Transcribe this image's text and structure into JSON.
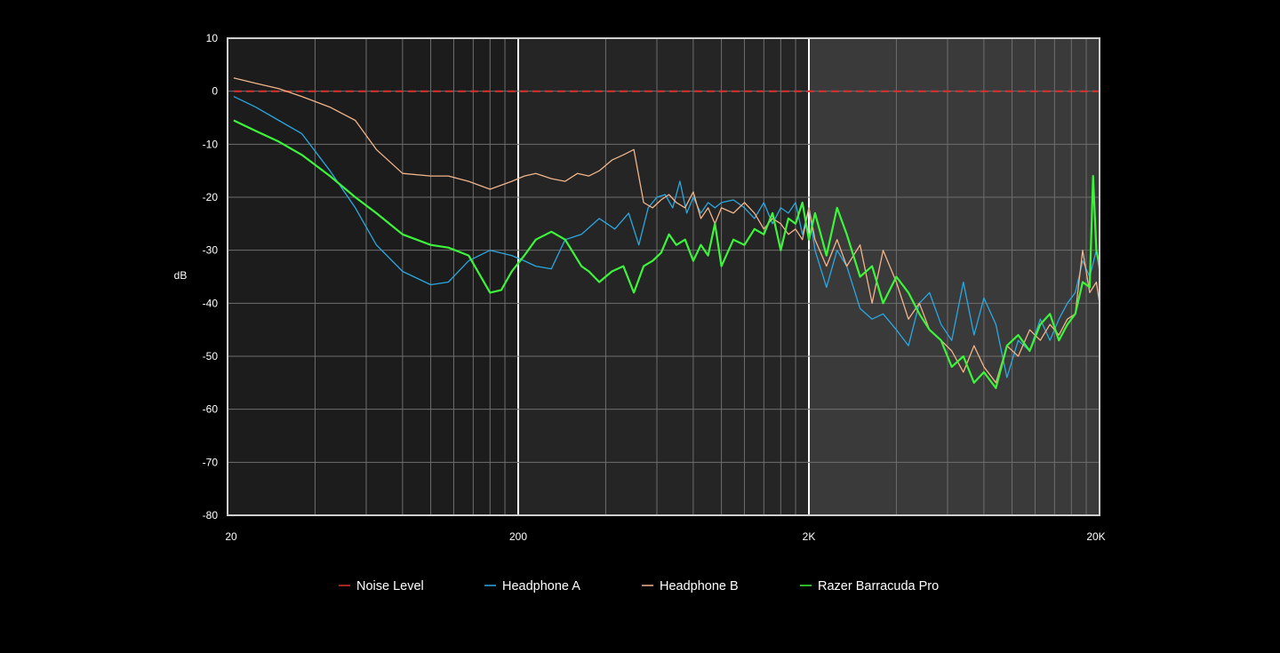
{
  "chart_data": {
    "type": "line",
    "title": "",
    "xlabel": "",
    "ylabel": "dB",
    "x_scale": "log",
    "xlim": [
      20,
      20000
    ],
    "ylim": [
      -80,
      10
    ],
    "x_ticks": [
      {
        "value": 20,
        "label": "20"
      },
      {
        "value": 200,
        "label": "200"
      },
      {
        "value": 2000,
        "label": "2K"
      },
      {
        "value": 20000,
        "label": "20K"
      }
    ],
    "y_ticks": [
      10,
      0,
      -10,
      -20,
      -30,
      -40,
      -50,
      -60,
      -70,
      -80
    ],
    "grid": true,
    "legend_position": "bottom",
    "series": [
      {
        "name": "Noise Level",
        "color": "#e0302a",
        "style": "dashed",
        "x": [
          21,
          20000
        ],
        "y": [
          0,
          0
        ]
      },
      {
        "name": "Headphone A",
        "color": "#2aa8e0",
        "style": "solid",
        "x": [
          21,
          25,
          30,
          36,
          45,
          55,
          65,
          80,
          100,
          115,
          135,
          160,
          190,
          210,
          230,
          260,
          290,
          330,
          380,
          430,
          480,
          520,
          560,
          600,
          640,
          680,
          720,
          760,
          800,
          850,
          900,
          950,
          1000,
          1100,
          1200,
          1300,
          1400,
          1500,
          1600,
          1700,
          1800,
          1900,
          2000,
          2100,
          2300,
          2500,
          2700,
          3000,
          3300,
          3600,
          4000,
          4400,
          4800,
          5200,
          5700,
          6200,
          6800,
          7400,
          8000,
          8800,
          9600,
          10500,
          11500,
          12500,
          13500,
          14500,
          15500,
          16500,
          17500,
          18500,
          19500,
          20000
        ],
        "y": [
          -1,
          -3,
          -5.5,
          -8,
          -15,
          -22,
          -29,
          -34,
          -36.5,
          -36,
          -32,
          -30,
          -31,
          -32,
          -33,
          -33.5,
          -28,
          -27,
          -24,
          -26,
          -23,
          -29,
          -22,
          -20,
          -19.5,
          -22,
          -17,
          -23,
          -20,
          -23,
          -21,
          -22,
          -21,
          -20.5,
          -22,
          -24,
          -21,
          -25,
          -22,
          -23,
          -21,
          -27,
          -22,
          -30,
          -37,
          -30,
          -33,
          -41,
          -43,
          -42,
          -45,
          -48,
          -40,
          -38,
          -44,
          -47,
          -36,
          -46,
          -39,
          -44,
          -54,
          -47,
          -49,
          -43,
          -47,
          -43,
          -40,
          -38,
          -32,
          -35,
          -30,
          -34
        ]
      },
      {
        "name": "Headphone B",
        "color": "#f2b48a",
        "style": "solid",
        "x": [
          21,
          25,
          30,
          36,
          45,
          55,
          65,
          80,
          100,
          115,
          135,
          160,
          190,
          210,
          230,
          260,
          290,
          320,
          350,
          380,
          420,
          460,
          500,
          540,
          580,
          620,
          660,
          700,
          750,
          800,
          850,
          900,
          950,
          1000,
          1100,
          1200,
          1300,
          1400,
          1500,
          1600,
          1700,
          1800,
          1900,
          2000,
          2100,
          2300,
          2500,
          2700,
          3000,
          3300,
          3600,
          4000,
          4400,
          4800,
          5200,
          5700,
          6200,
          6800,
          7400,
          8000,
          8800,
          9600,
          10500,
          11500,
          12500,
          13500,
          14500,
          15500,
          16500,
          17500,
          18500,
          19500,
          20000
        ],
        "y": [
          2.5,
          1.5,
          0.5,
          -1,
          -3,
          -5.5,
          -11,
          -15.5,
          -16,
          -16,
          -17,
          -18.5,
          -17,
          -16,
          -15.5,
          -16.5,
          -17,
          -15.5,
          -16,
          -15,
          -13,
          -12,
          -11,
          -21,
          -22,
          -20.5,
          -19.5,
          -21,
          -22,
          -19,
          -24,
          -22,
          -25,
          -22,
          -23,
          -21,
          -23,
          -26,
          -24,
          -25,
          -27,
          -26,
          -28,
          -22,
          -28,
          -33,
          -28,
          -33,
          -29,
          -40,
          -30,
          -36,
          -43,
          -40,
          -45,
          -47,
          -49,
          -53,
          -48,
          -52,
          -55,
          -48,
          -50,
          -45,
          -47,
          -44,
          -46,
          -43,
          -42,
          -30,
          -38,
          -36,
          -40
        ]
      },
      {
        "name": "Razer Barracuda Pro",
        "color": "#3cf53a",
        "style": "solid",
        "x": [
          21,
          25,
          30,
          36,
          45,
          55,
          65,
          80,
          100,
          115,
          135,
          160,
          175,
          190,
          210,
          230,
          260,
          290,
          330,
          350,
          380,
          420,
          460,
          500,
          540,
          580,
          620,
          660,
          700,
          750,
          800,
          850,
          900,
          950,
          1000,
          1100,
          1200,
          1300,
          1400,
          1500,
          1600,
          1700,
          1800,
          1900,
          2000,
          2100,
          2300,
          2500,
          2700,
          3000,
          3300,
          3600,
          4000,
          4400,
          4800,
          5200,
          5700,
          6200,
          6800,
          7400,
          8000,
          8800,
          9600,
          10500,
          11500,
          12500,
          13500,
          14500,
          15500,
          16500,
          17500,
          18500,
          19000,
          19500,
          20000
        ],
        "y": [
          -5.5,
          -7.5,
          -9.5,
          -12,
          -16,
          -20,
          -23,
          -27,
          -29,
          -29.5,
          -31,
          -38,
          -37.5,
          -34,
          -31,
          -28,
          -26.5,
          -28,
          -33,
          -34,
          -36,
          -34,
          -33,
          -38,
          -33,
          -32,
          -30.5,
          -27,
          -29,
          -28,
          -32,
          -29,
          -31,
          -25,
          -33,
          -28,
          -29,
          -26,
          -27,
          -23,
          -30,
          -24,
          -25,
          -21,
          -28,
          -23,
          -31,
          -22,
          -27,
          -35,
          -33,
          -40,
          -35,
          -38,
          -42,
          -45,
          -47,
          -52,
          -50,
          -55,
          -53,
          -56,
          -48,
          -46,
          -49,
          -44,
          -42,
          -47,
          -44,
          -42,
          -36,
          -37,
          -16,
          -30,
          -33
        ]
      }
    ]
  }
}
